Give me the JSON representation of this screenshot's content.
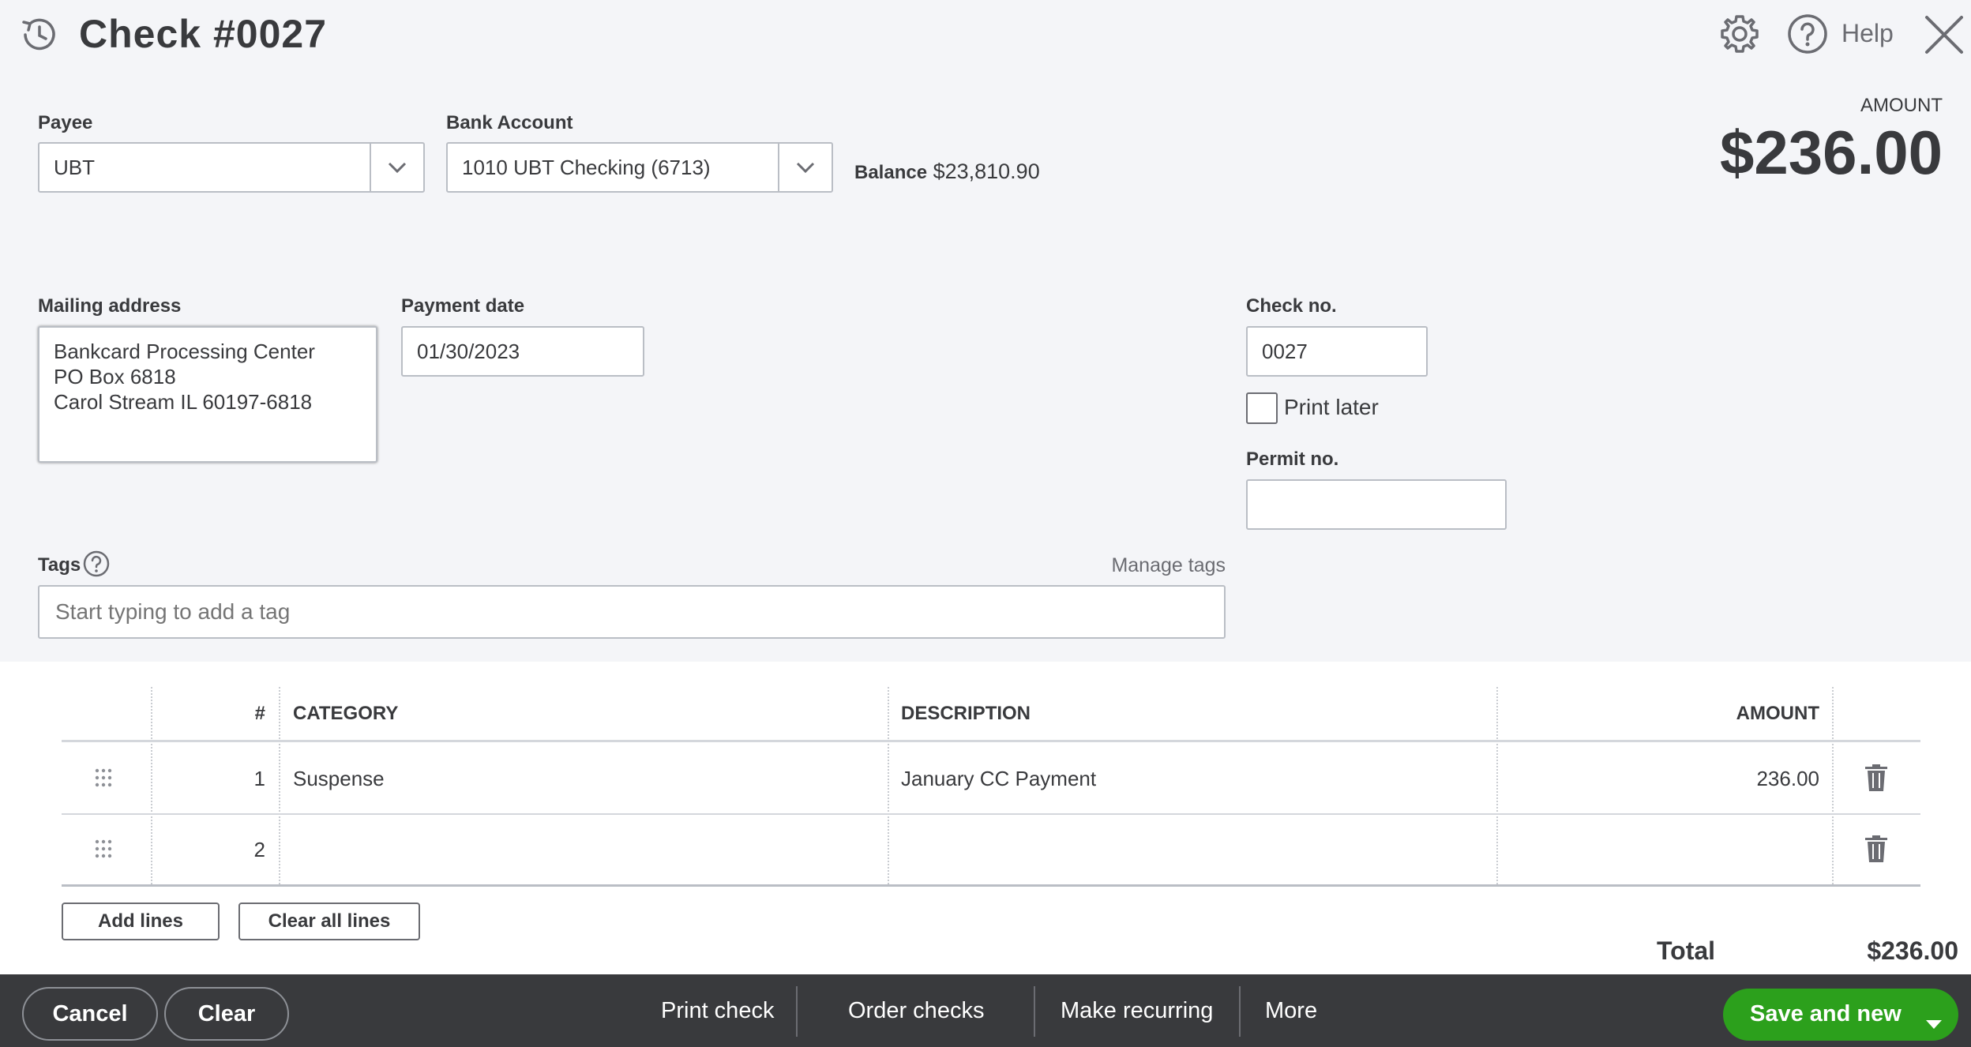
{
  "header": {
    "title": "Check #0027",
    "help_label": "Help"
  },
  "amount": {
    "label": "AMOUNT",
    "value": "$236.00"
  },
  "payee": {
    "label": "Payee",
    "value": "UBT"
  },
  "bank_account": {
    "label": "Bank Account",
    "value": "1010 UBT Checking (6713)",
    "balance_label": "Balance",
    "balance_value": "$23,810.90"
  },
  "mailing_address": {
    "label": "Mailing address",
    "lines": [
      "Bankcard Processing Center",
      "PO Box 6818",
      "Carol Stream IL 60197-6818"
    ]
  },
  "payment_date": {
    "label": "Payment date",
    "value": "01/30/2023"
  },
  "check_no": {
    "label": "Check no.",
    "value": "0027",
    "print_later_label": "Print later"
  },
  "permit_no": {
    "label": "Permit no.",
    "value": ""
  },
  "tags": {
    "label": "Tags",
    "manage_label": "Manage tags",
    "placeholder": "Start typing to add a tag"
  },
  "table": {
    "columns": [
      "#",
      "CATEGORY",
      "DESCRIPTION",
      "AMOUNT"
    ],
    "rows": [
      {
        "num": "1",
        "category": "Suspense",
        "description": "January CC Payment",
        "amount": "236.00"
      },
      {
        "num": "2",
        "category": "",
        "description": "",
        "amount": ""
      }
    ],
    "add_lines_label": "Add lines",
    "clear_all_label": "Clear all lines",
    "total_label": "Total",
    "total_value": "$236.00"
  },
  "footer": {
    "cancel_label": "Cancel",
    "clear_label": "Clear",
    "print_check_label": "Print check",
    "order_checks_label": "Order checks",
    "make_recurring_label": "Make recurring",
    "more_label": "More",
    "save_new_label": "Save and new"
  },
  "colors": {
    "primary_green": "#2ca01c",
    "footer_bg": "#393a3d",
    "page_bg": "#f4f5f8"
  }
}
